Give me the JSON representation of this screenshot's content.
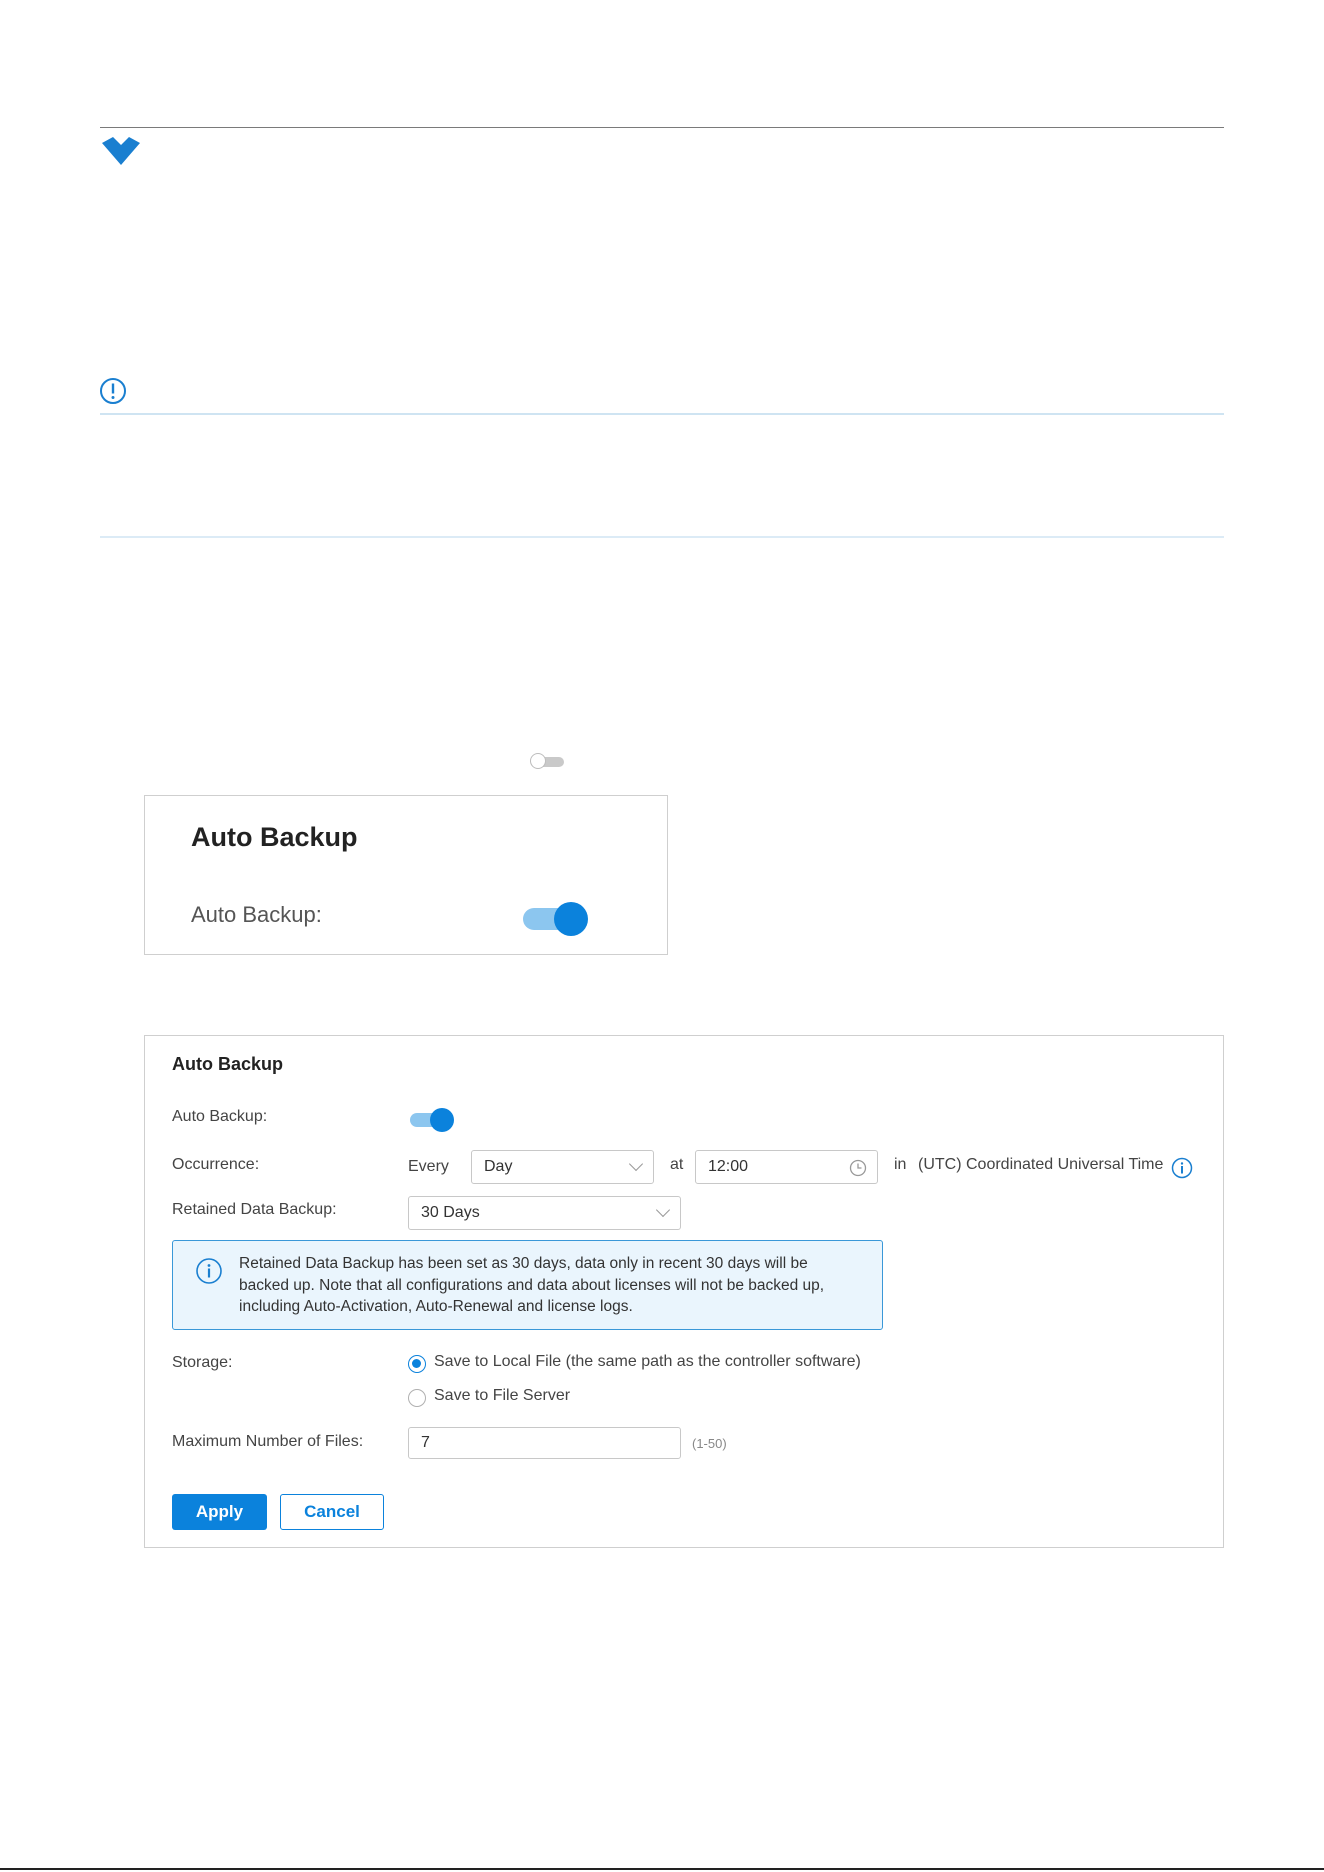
{
  "colors": {
    "accent": "#0b82dc",
    "accent_light": "#8cc6ef",
    "info_bg": "#eaf5fd",
    "info_border": "#3a98d8"
  },
  "icons": {
    "top": "chevron-down-icon",
    "note": "exclamation-circle-icon",
    "info": "info-circle-icon",
    "time": "clock-icon"
  },
  "mini_toggle": {
    "state": "off"
  },
  "screenshot1": {
    "title": "Auto Backup",
    "auto_backup_label": "Auto Backup:",
    "auto_backup_state": "on"
  },
  "panel": {
    "title": "Auto Backup",
    "auto_backup": {
      "label": "Auto Backup:",
      "state": "on"
    },
    "occurrence": {
      "label": "Occurrence:",
      "every_label": "Every",
      "frequency": "Day",
      "at_label": "at",
      "time": "12:00",
      "in_label": "in",
      "timezone": "(UTC) Coordinated Universal Time"
    },
    "retained": {
      "label": "Retained Data Backup:",
      "value": "30 Days"
    },
    "info_text": "Retained Data Backup has been set as 30 days, data only in recent 30 days will be backed up. Note that all configurations and data about licenses will not be backed up, including Auto-Activation, Auto-Renewal and license logs.",
    "storage": {
      "label": "Storage:",
      "options": [
        {
          "label": "Save to Local File (the same path as the controller software)",
          "selected": true
        },
        {
          "label": "Save to File Server",
          "selected": false
        }
      ]
    },
    "max_files": {
      "label": "Maximum Number of Files:",
      "value": "7",
      "hint": "(1-50)"
    },
    "buttons": {
      "apply": "Apply",
      "cancel": "Cancel"
    }
  }
}
